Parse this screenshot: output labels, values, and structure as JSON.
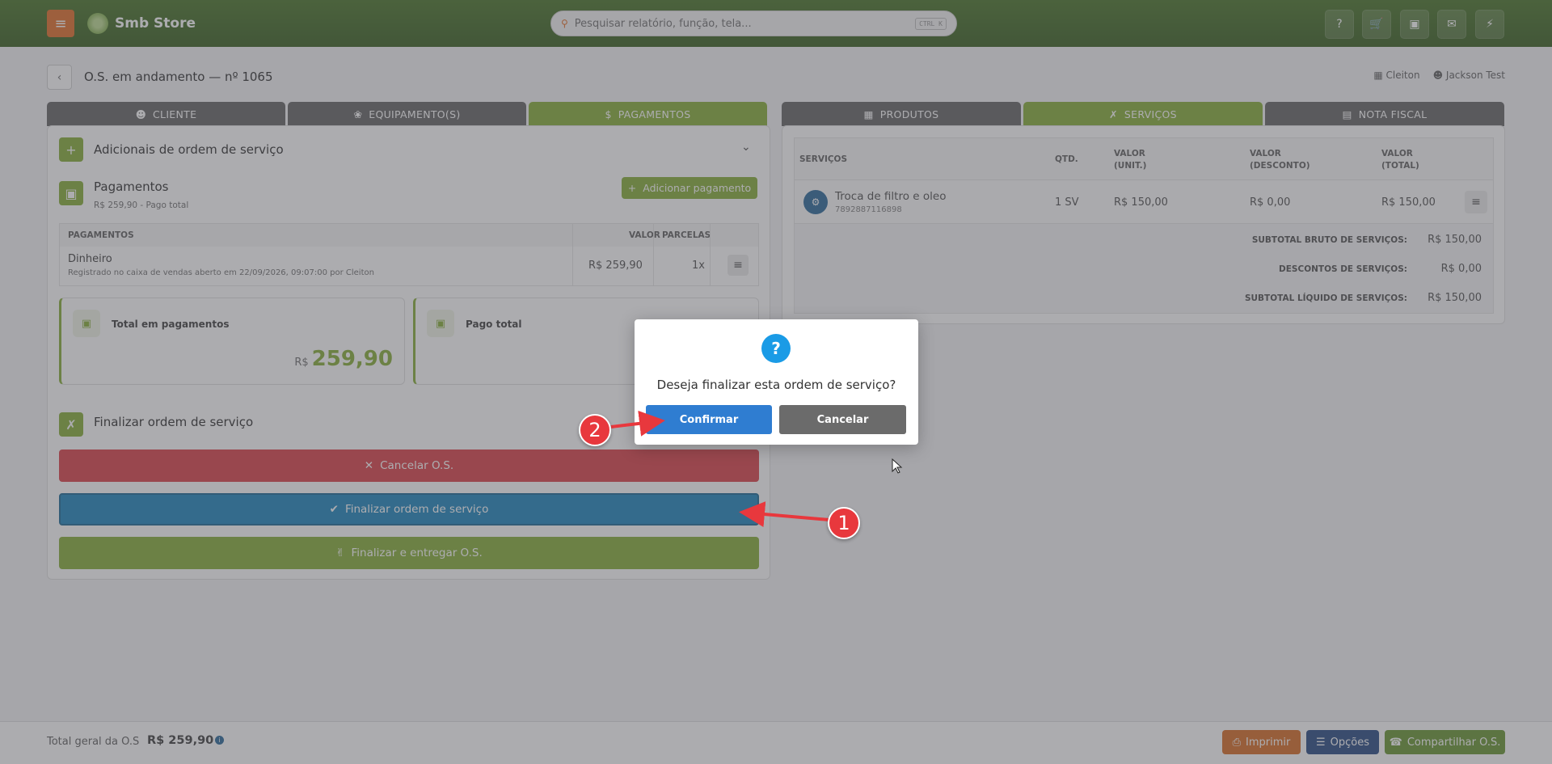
{
  "topbar": {
    "brand": "Smb Store",
    "search_placeholder": "Pesquisar relatório, função, tela...",
    "search_shortcut": "CTRL K"
  },
  "header": {
    "title": "O.S. em andamento — nº 1065",
    "store": "Cleiton",
    "user": "Jackson Test"
  },
  "left_tabs": [
    "CLIENTE",
    "EQUIPAMENTO(S)",
    "PAGAMENTOS"
  ],
  "right_tabs": [
    "PRODUTOS",
    "SERVIÇOS",
    "NOTA FISCAL"
  ],
  "left": {
    "additions_title": "Adicionais de ordem de serviço",
    "payments_title": "Pagamentos",
    "payments_subtitle": "R$ 259,90 - Pago total",
    "add_payment_label": "Adicionar pagamento",
    "table_headers": [
      "PAGAMENTOS",
      "VALOR",
      "PARCELAS"
    ],
    "payment_row": {
      "method": "Dinheiro",
      "note": "Registrado no caixa de vendas aberto em 22/09/2026, 09:07:00 por Cleiton",
      "value": "R$ 259,90",
      "installments": "1x"
    },
    "total_card": {
      "label": "Total em pagamentos",
      "currency": "R$",
      "amount": "259,90"
    },
    "paid_card": {
      "label": "Pago total"
    },
    "finalize_title": "Finalizar ordem de serviço",
    "cancel_btn": "Cancelar O.S.",
    "finalize_btn": "Finalizar ordem de serviço",
    "deliver_btn": "Finalizar e entregar O.S."
  },
  "right": {
    "headers": [
      "SERVIÇOS",
      "QTD.",
      "VALOR\n(UNIT.)",
      "VALOR\n(DESCONTO)",
      "VALOR\n(TOTAL)"
    ],
    "header_cells": {
      "services": "SERVIÇOS",
      "qty": "QTD.",
      "unit_1": "VALOR",
      "unit_2": "(UNIT.)",
      "disc_1": "VALOR",
      "disc_2": "(DESCONTO)",
      "total_1": "VALOR",
      "total_2": "(TOTAL)"
    },
    "service": {
      "name": "Troca de filtro e oleo",
      "code": "7892887116898",
      "qty": "1 SV",
      "unit": "R$ 150,00",
      "discount": "R$ 0,00",
      "total": "R$ 150,00"
    },
    "subtotal_gross_label": "SUBTOTAL BRUTO DE SERVIÇOS:",
    "subtotal_gross": "R$ 150,00",
    "discounts_label": "DESCONTOS DE SERVIÇOS:",
    "discounts": "R$ 0,00",
    "subtotal_net_label": "SUBTOTAL LÍQUIDO DE SERVIÇOS:",
    "subtotal_net": "R$ 150,00"
  },
  "dialog": {
    "icon": "?",
    "message": "Deseja finalizar esta ordem de serviço?",
    "confirm": "Confirmar",
    "cancel": "Cancelar"
  },
  "markers": {
    "one": "1",
    "two": "2"
  },
  "footer": {
    "total_label": "Total geral da O.S",
    "total_value": "R$ 259,90",
    "print": "Imprimir",
    "options": "Opções",
    "share": "Compartilhar O.S."
  },
  "colors": {
    "brand_green": "#7fa82b",
    "topbar": "#2f5a13",
    "danger": "#d9353c",
    "primary": "#0f7cb8",
    "dialog_confirm": "#2f7dd1",
    "dialog_cancel": "#6b6b6b"
  }
}
